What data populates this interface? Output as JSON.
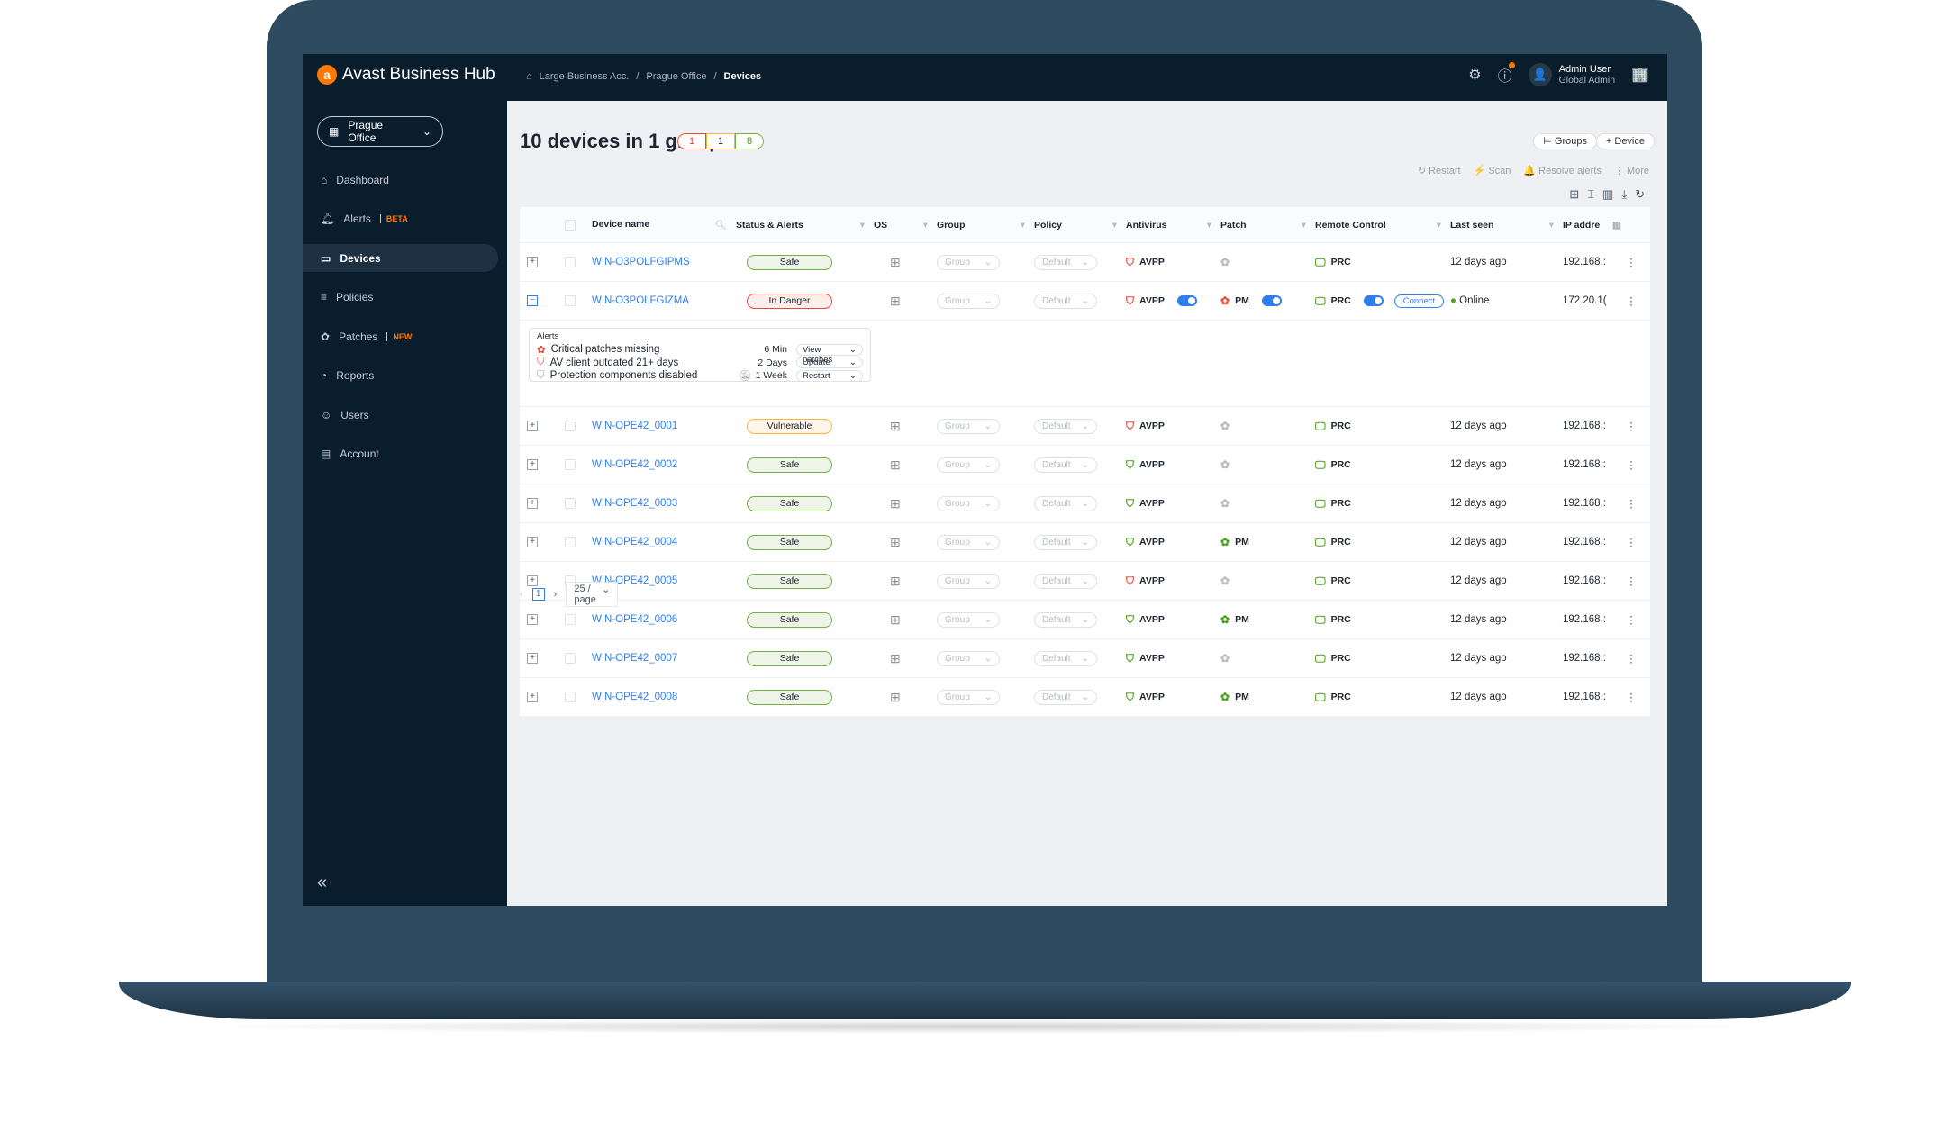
{
  "app": {
    "logo_text": "Avast Business Hub",
    "breadcrumb": [
      "Large Business Acc.",
      "Prague Office",
      "Devices"
    ],
    "user_name": "Admin User",
    "user_role": "Global Admin"
  },
  "sidebar": {
    "location": "Prague Office",
    "items": [
      {
        "label": "Dashboard",
        "icon": "home-icon"
      },
      {
        "label": "Alerts",
        "tag": "BETA",
        "icon": "bell-icon"
      },
      {
        "label": "Devices",
        "icon": "monitor-icon",
        "active": true
      },
      {
        "label": "Policies",
        "icon": "policy-icon"
      },
      {
        "label": "Patches",
        "tag": "NEW",
        "icon": "patch-icon"
      },
      {
        "label": "Reports",
        "icon": "pie-icon"
      },
      {
        "label": "Users",
        "icon": "user-icon"
      },
      {
        "label": "Account",
        "icon": "account-icon"
      }
    ]
  },
  "main": {
    "title": "10 devices in 1 group",
    "counts": {
      "danger": "1",
      "vulnerable": "1",
      "safe": "8"
    },
    "groups_btn": "Groups",
    "device_btn": "Device",
    "actions": [
      "Restart",
      "Scan",
      "Resolve alerts",
      "More"
    ]
  },
  "table": {
    "columns": [
      "Device name",
      "Status & Alerts",
      "OS",
      "Group",
      "Policy",
      "Antivirus",
      "Patch",
      "Remote Control",
      "Last seen",
      "IP addre"
    ],
    "rows": [
      {
        "name": "WIN-O3POLFGIPMS",
        "status": "Safe",
        "group": "Group",
        "policy": "Default",
        "av": "AVPP",
        "av_ok": false,
        "patch": "",
        "patch_state": "none",
        "rc": "PRC",
        "last": "12 days ago",
        "ip": "192.168.:"
      },
      {
        "name": "WIN-O3POLFGIZMA",
        "status": "In Danger",
        "group": "Group",
        "policy": "Default",
        "av": "AVPP",
        "av_ok": false,
        "av_toggle": true,
        "patch": "PM",
        "patch_state": "danger",
        "patch_toggle": true,
        "rc": "PRC",
        "rc_toggle": true,
        "connect": "Connect",
        "last": "Online",
        "ip": "172.20.1(",
        "expanded": true
      },
      {
        "name": "WIN-OPE42_0001",
        "status": "Vulnerable",
        "group": "Group",
        "policy": "Default",
        "av": "AVPP",
        "av_ok": false,
        "patch": "",
        "patch_state": "none",
        "rc": "PRC",
        "last": "12 days ago",
        "ip": "192.168.:"
      },
      {
        "name": "WIN-OPE42_0002",
        "status": "Safe",
        "group": "Group",
        "policy": "Default",
        "av": "AVPP",
        "av_ok": true,
        "patch": "",
        "patch_state": "none",
        "rc": "PRC",
        "last": "12 days ago",
        "ip": "192.168.:"
      },
      {
        "name": "WIN-OPE42_0003",
        "status": "Safe",
        "group": "Group",
        "policy": "Default",
        "av": "AVPP",
        "av_ok": true,
        "patch": "",
        "patch_state": "none",
        "rc": "PRC",
        "last": "12 days ago",
        "ip": "192.168.:"
      },
      {
        "name": "WIN-OPE42_0004",
        "status": "Safe",
        "group": "Group",
        "policy": "Default",
        "av": "AVPP",
        "av_ok": true,
        "patch": "PM",
        "patch_state": "ok",
        "rc": "PRC",
        "last": "12 days ago",
        "ip": "192.168.:"
      },
      {
        "name": "WIN-OPE42_0005",
        "status": "Safe",
        "group": "Group",
        "policy": "Default",
        "av": "AVPP",
        "av_ok": false,
        "patch": "",
        "patch_state": "none",
        "rc": "PRC",
        "last": "12 days ago",
        "ip": "192.168.:"
      },
      {
        "name": "WIN-OPE42_0006",
        "status": "Safe",
        "group": "Group",
        "policy": "Default",
        "av": "AVPP",
        "av_ok": true,
        "patch": "PM",
        "patch_state": "ok",
        "rc": "PRC",
        "last": "12 days ago",
        "ip": "192.168.:"
      },
      {
        "name": "WIN-OPE42_0007",
        "status": "Safe",
        "group": "Group",
        "policy": "Default",
        "av": "AVPP",
        "av_ok": true,
        "patch": "",
        "patch_state": "none",
        "rc": "PRC",
        "last": "12 days ago",
        "ip": "192.168.:"
      },
      {
        "name": "WIN-OPE42_0008",
        "status": "Safe",
        "group": "Group",
        "policy": "Default",
        "av": "AVPP",
        "av_ok": true,
        "patch": "PM",
        "patch_state": "ok",
        "rc": "PRC",
        "last": "12 days ago",
        "ip": "192.168.:"
      }
    ],
    "alerts": {
      "label": "Alerts",
      "items": [
        {
          "text": "Critical patches missing",
          "time": "6 Min",
          "action": "View patches",
          "icon": "patch-icon"
        },
        {
          "text": "AV client outdated 21+ days",
          "time": "2 Days",
          "action": "Update",
          "icon": "shield-icon"
        },
        {
          "text": "Protection components disabled",
          "time": "1 Week",
          "action": "Restart",
          "icon": "shield-icon",
          "muted": true
        }
      ]
    }
  },
  "pagination": {
    "page": "1",
    "per_page": "25 / page"
  },
  "colors": {
    "accent": "#2d7ff0",
    "danger": "#e84a3a",
    "safe": "#72b043",
    "warn": "#f5b83d",
    "brand": "#ff7800"
  }
}
